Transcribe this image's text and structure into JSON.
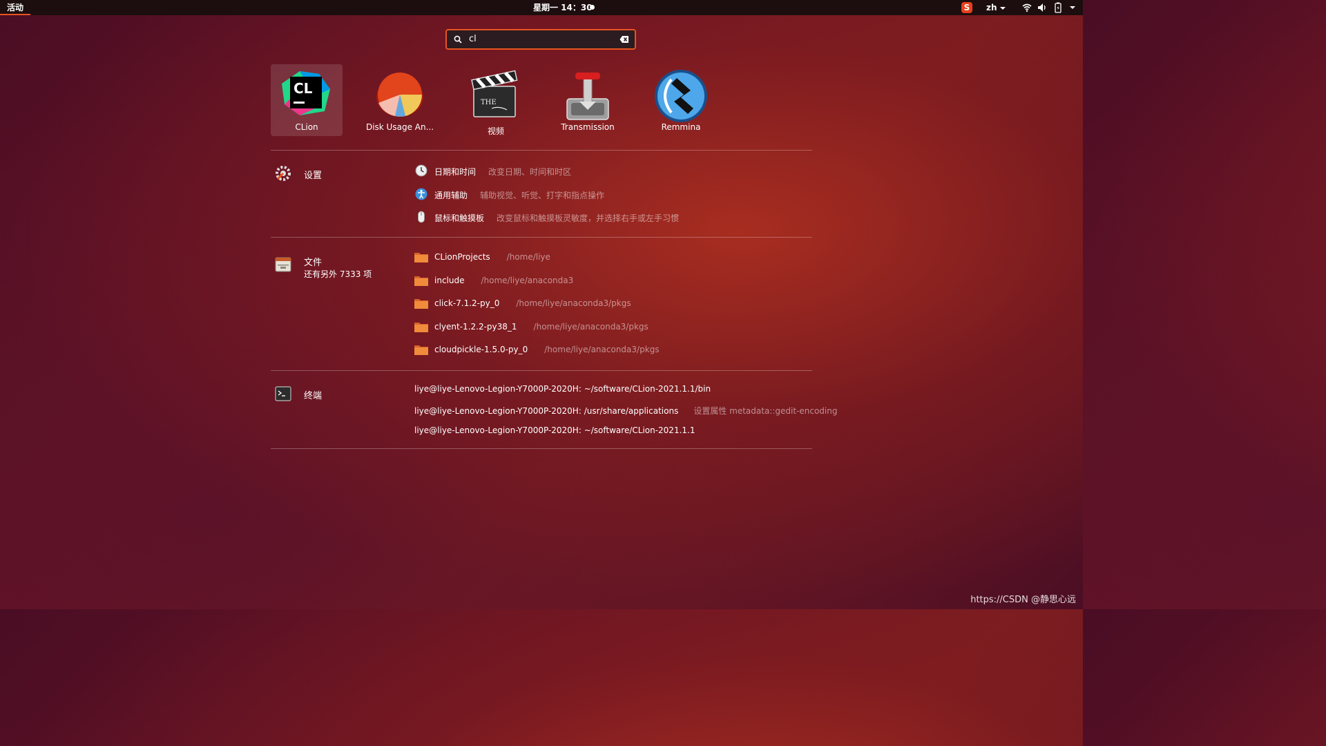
{
  "topbar": {
    "activities": "活动",
    "clock": "星期一 14：30",
    "input_method_icon": "S",
    "language": "zh"
  },
  "search": {
    "value": "cl"
  },
  "apps": [
    {
      "label": "CLion",
      "icon": "clion-icon"
    },
    {
      "label": "Disk Usage An...",
      "icon": "disk-usage-icon"
    },
    {
      "label": "视频",
      "icon": "video-icon"
    },
    {
      "label": "Transmission",
      "icon": "transmission-icon"
    },
    {
      "label": "Remmina",
      "icon": "remmina-icon"
    }
  ],
  "settings": {
    "title": "设置",
    "items": [
      {
        "label": "日期和时间",
        "desc": "改变日期、时间和时区"
      },
      {
        "label": "通用辅助",
        "desc": "辅助视觉、听觉、打字和指点操作"
      },
      {
        "label": "鼠标和触摸板",
        "desc": "改变鼠标和触摸板灵敏度，并选择右手或左手习惯"
      }
    ]
  },
  "files": {
    "title": "文件",
    "more": "还有另外 7333 项",
    "items": [
      {
        "label": "CLionProjects",
        "path": "/home/liye"
      },
      {
        "label": "include",
        "path": "/home/liye/anaconda3"
      },
      {
        "label": "click-7.1.2-py_0",
        "path": "/home/liye/anaconda3/pkgs"
      },
      {
        "label": "clyent-1.2.2-py38_1",
        "path": "/home/liye/anaconda3/pkgs"
      },
      {
        "label": "cloudpickle-1.5.0-py_0",
        "path": "/home/liye/anaconda3/pkgs"
      }
    ]
  },
  "terminal": {
    "title": "终端",
    "items": [
      {
        "label": "liye@liye-Lenovo-Legion-Y7000P-2020H: ~/software/CLion-2021.1.1/bin",
        "desc": ""
      },
      {
        "label": "liye@liye-Lenovo-Legion-Y7000P-2020H: /usr/share/applications",
        "desc": "设置属性 metadata::gedit-encoding"
      },
      {
        "label": "liye@liye-Lenovo-Legion-Y7000P-2020H: ~/software/CLion-2021.1.1",
        "desc": ""
      }
    ]
  },
  "watermark": "https://CSDN @静思心远"
}
